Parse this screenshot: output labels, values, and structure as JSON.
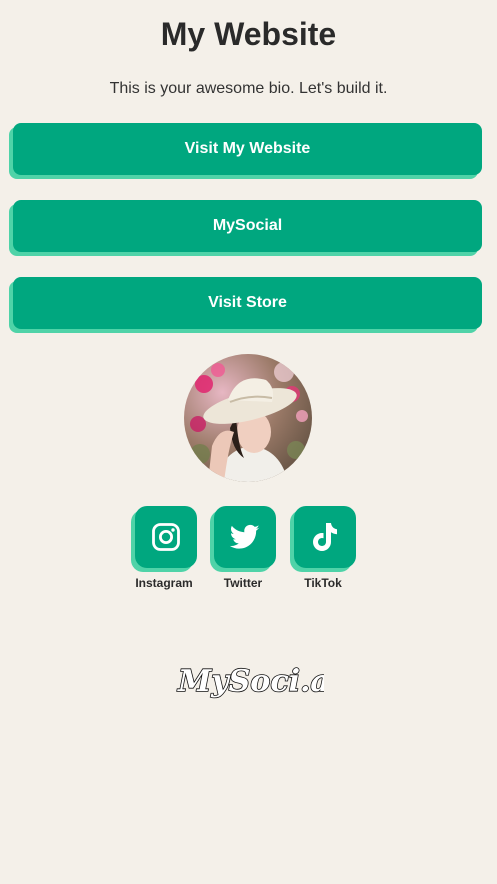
{
  "header": {
    "title": "My Website",
    "bio": "This is your awesome bio. Let's build it."
  },
  "links": [
    {
      "label": "Visit My Website"
    },
    {
      "label": "MySocial"
    },
    {
      "label": "Visit Store"
    }
  ],
  "profile": {
    "avatar_icon": "profile-photo"
  },
  "socials": [
    {
      "label": "Instagram",
      "icon": "instagram-icon"
    },
    {
      "label": "Twitter",
      "icon": "twitter-icon"
    },
    {
      "label": "TikTok",
      "icon": "tiktok-icon"
    }
  ],
  "footer": {
    "logo_text": "MySoci.al"
  },
  "colors": {
    "background": "#f4f0e9",
    "accent": "#00a77f",
    "accent_shadow": "#4fd3a8",
    "text": "#2b2b2b"
  }
}
